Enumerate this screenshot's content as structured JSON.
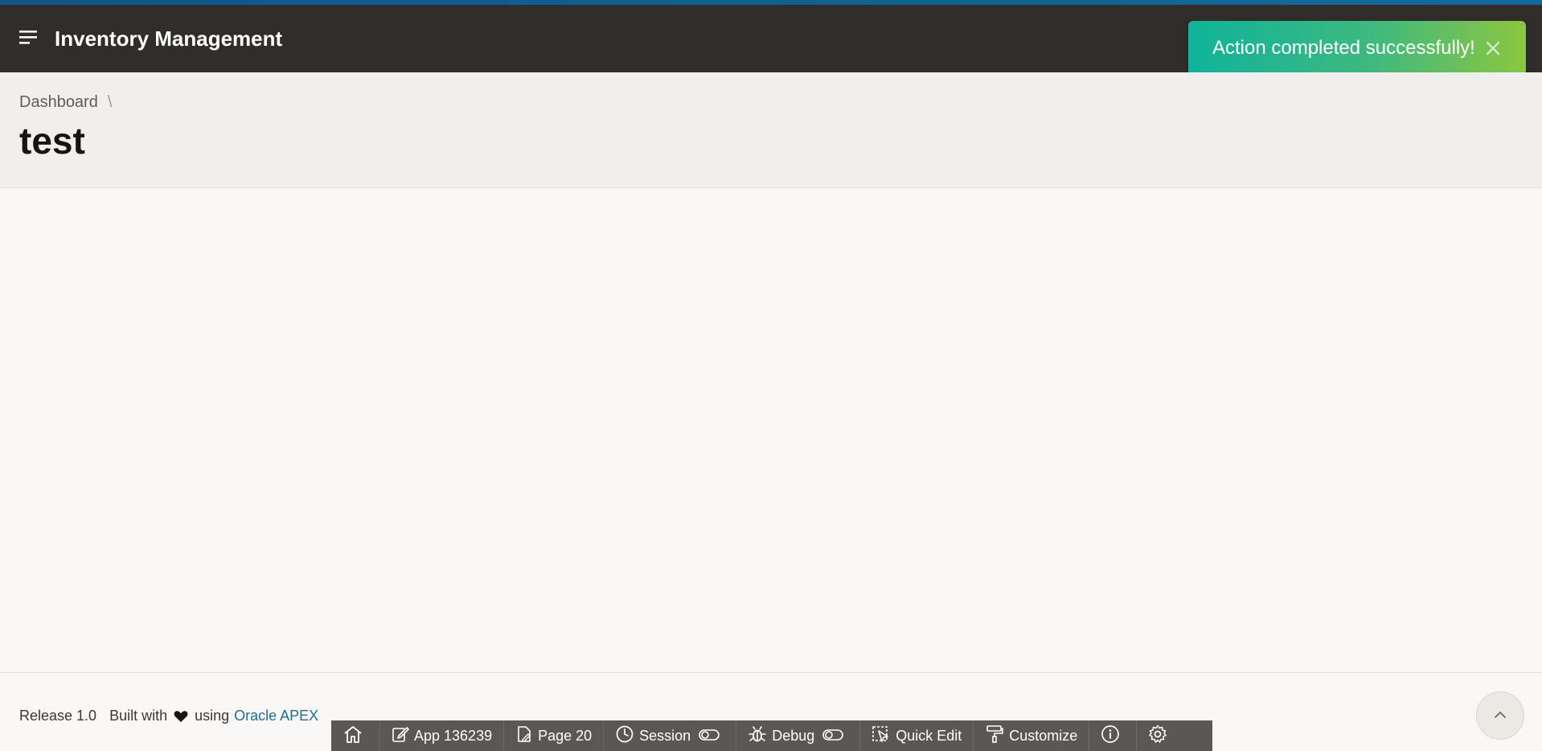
{
  "header": {
    "app_title": "Inventory Management",
    "menu_icon": "hamburger-icon",
    "background": "#312d2a",
    "accent": "#0e6e96"
  },
  "toast": {
    "message": "Action completed successfully!",
    "close_icon": "close-icon",
    "colors": [
      "#0fb39b",
      "#8cc63f"
    ]
  },
  "breadcrumb": {
    "items": [
      "Dashboard"
    ],
    "separator": "\\"
  },
  "page": {
    "title": "test"
  },
  "footer": {
    "release": "Release 1.0",
    "built_with": "Built with",
    "using": "using",
    "link_text": "Oracle APEX",
    "heart_icon": "heart-icon"
  },
  "dev_toolbar": {
    "home_icon": "home-icon",
    "app": "App 136239",
    "page": "Page 20",
    "session": "Session",
    "debug": "Debug",
    "quick_edit": "Quick Edit",
    "customize": "Customize",
    "info_icon": "info-icon",
    "settings_icon": "gear-icon"
  },
  "scroll_top_icon": "chevron-up-icon"
}
